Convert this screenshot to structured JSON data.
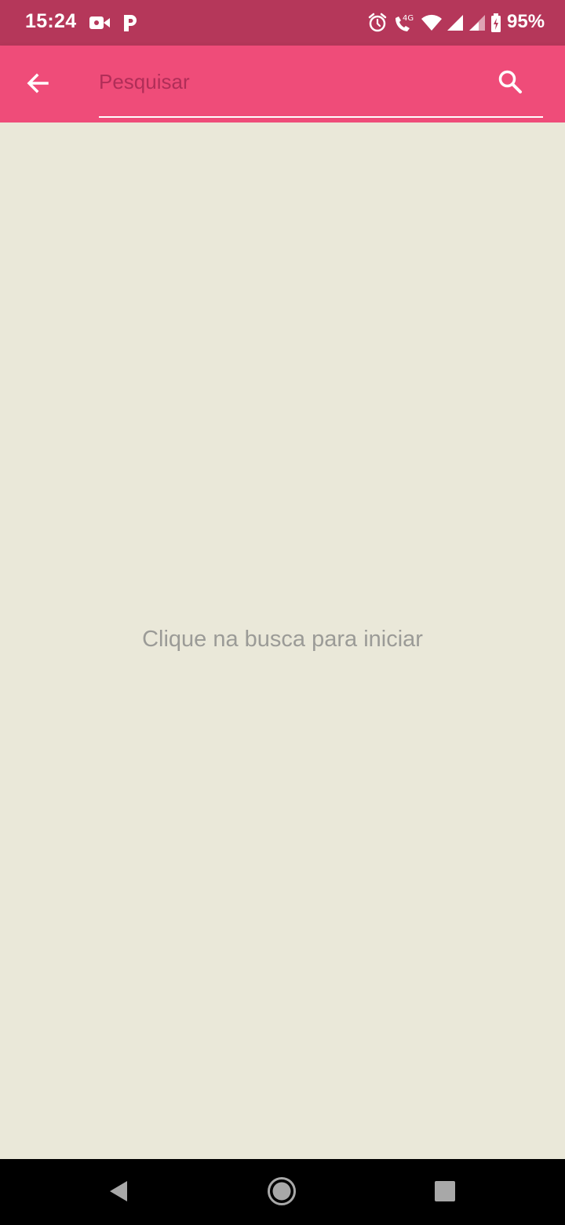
{
  "status_bar": {
    "time": "15:24",
    "battery_percent": "95%",
    "network_label": "4G",
    "icons": [
      "video-camera-icon",
      "parking-p-icon",
      "alarm-icon",
      "volte-call-icon",
      "wifi-icon",
      "signal-icon",
      "signal-icon-2",
      "battery-charging-icon"
    ]
  },
  "app_bar": {
    "color": "#ef4c79",
    "search": {
      "placeholder": "Pesquisar",
      "value": ""
    },
    "icons": [
      "back-arrow-icon",
      "search-icon"
    ]
  },
  "main": {
    "background": "#eae8d9",
    "empty_message": "Clique na busca para iniciar"
  },
  "nav_bar": {
    "icons": [
      "back-triangle-icon",
      "home-circle-icon",
      "recents-square-icon"
    ]
  }
}
